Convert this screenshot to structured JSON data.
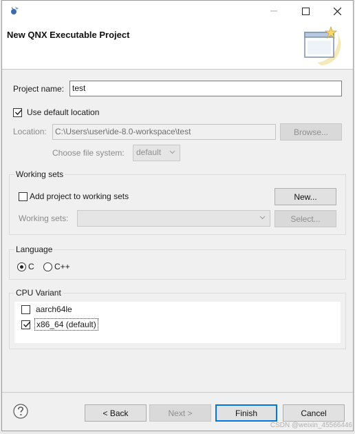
{
  "window": {
    "title": "New QNX Executable Project",
    "controls": {
      "minimize": "minimize",
      "maximize": "maximize",
      "close": "close"
    }
  },
  "form": {
    "project_name_label": "Project name:",
    "project_name_value": "test",
    "use_default_location_label": "Use default location",
    "use_default_location_checked": true,
    "location_label": "Location:",
    "location_value": "C:\\Users\\user\\ide-8.0-workspace\\test",
    "browse_button": "Browse...",
    "file_system_label": "Choose file system:",
    "file_system_value": "default"
  },
  "working_sets": {
    "title": "Working sets",
    "add_label": "Add project to working sets",
    "add_checked": false,
    "new_button": "New...",
    "sets_label": "Working sets:",
    "sets_value": "",
    "select_button": "Select..."
  },
  "language": {
    "title": "Language",
    "options": [
      {
        "label": "C",
        "selected": true
      },
      {
        "label": "C++",
        "selected": false
      }
    ]
  },
  "cpu_variant": {
    "title": "CPU Variant",
    "items": [
      {
        "label": "aarch64le",
        "checked": false
      },
      {
        "label": "x86_64 (default)",
        "checked": true
      }
    ]
  },
  "footer": {
    "back_button": "< Back",
    "next_button": "Next >",
    "finish_button": "Finish",
    "cancel_button": "Cancel",
    "watermark": "CSDN @weixin_45566446"
  },
  "colors": {
    "accent": "#0078d7",
    "background": "#f0f0f0"
  }
}
